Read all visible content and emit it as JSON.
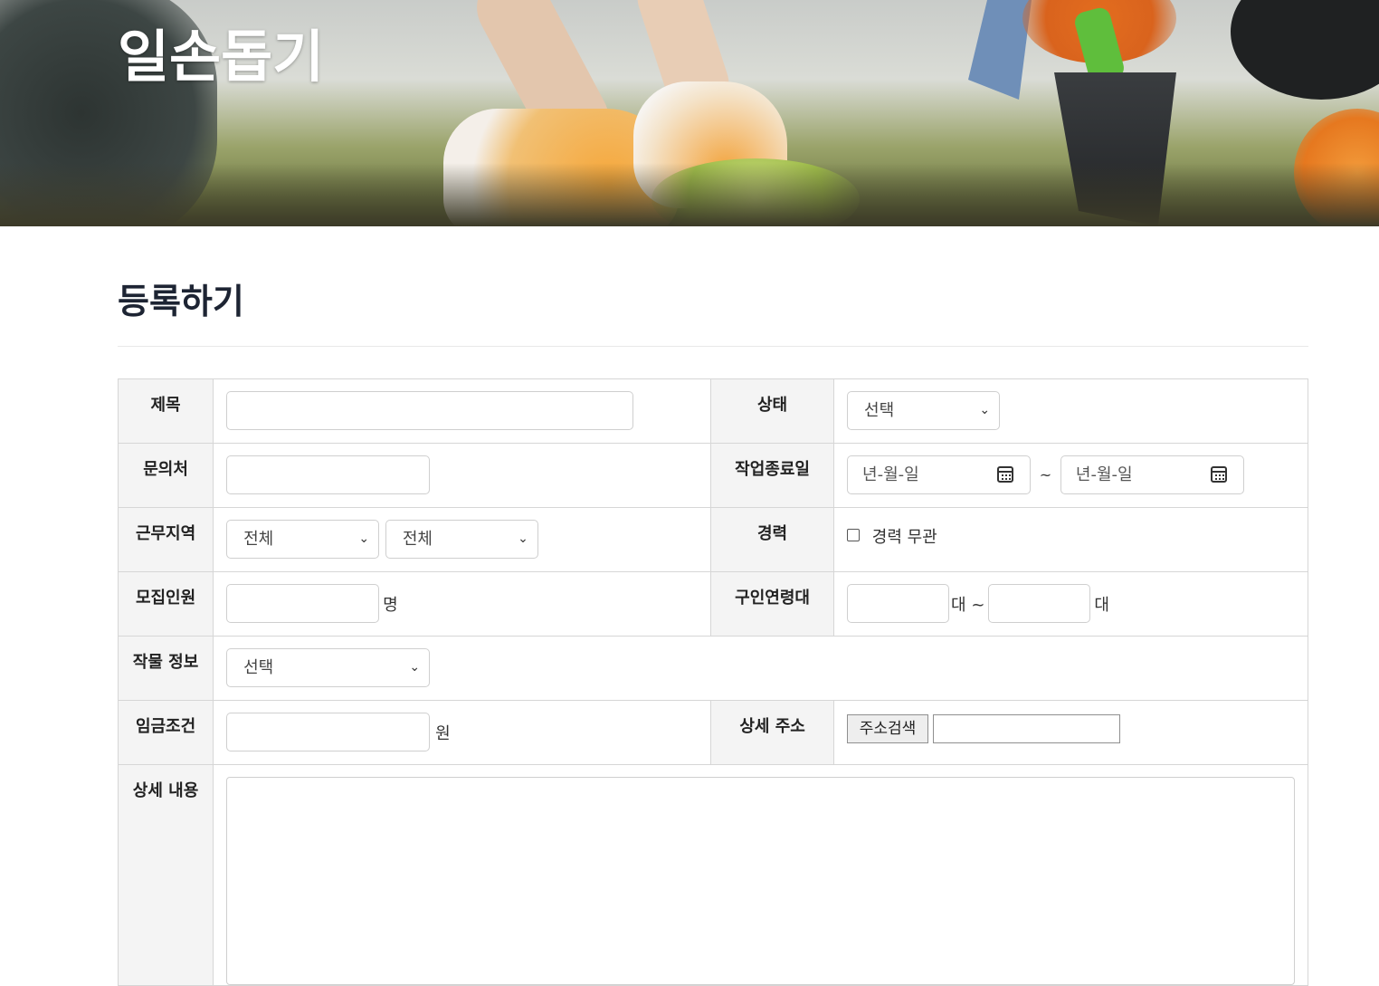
{
  "site": {
    "title": "일손돕기"
  },
  "page": {
    "title": "등록하기"
  },
  "form": {
    "title_label": "제목",
    "status_label": "상태",
    "status_value": "선택",
    "contact_label": "문의처",
    "end_date_label": "작업종료일",
    "date_placeholder": "년-월-일",
    "date_separator": "~",
    "region_label": "근무지역",
    "region_primary": "전체",
    "region_secondary": "전체",
    "career_label": "경력",
    "career_checkbox": "경력 무관",
    "recruit_label": "모집인원",
    "recruit_unit": "명",
    "age_label": "구인연령대",
    "age_unit_from": "대 ~",
    "age_unit_to": "대",
    "crop_label": "작물 정보",
    "crop_value": "선택",
    "wage_label": "임금조건",
    "wage_unit": "원",
    "address_label": "상세 주소",
    "address_button": "주소검색",
    "detail_label": "상세 내용"
  }
}
